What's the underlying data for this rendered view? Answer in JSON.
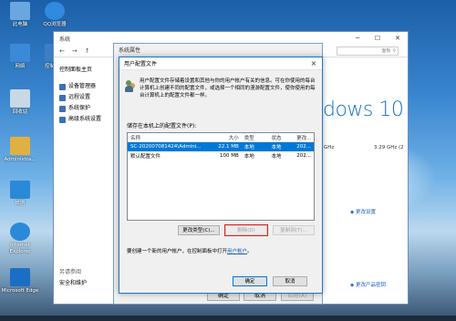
{
  "desktop": {
    "icons": [
      {
        "label": "此电脑",
        "icon": "computer-icon",
        "color": "#6aa7e0"
      },
      {
        "label": "QQ浏览器",
        "icon": "qq-browser-icon",
        "color": "#2f8ae0"
      },
      {
        "label": "网络",
        "icon": "network-icon",
        "color": "#3a8ad8"
      },
      {
        "label": "控制面板",
        "icon": "control-panel-icon",
        "color": "#3b7fc4"
      },
      {
        "label": "回收站",
        "icon": "recycle-bin-icon",
        "color": "#c9d8e6"
      },
      {
        "label": "Administra...",
        "icon": "user-folder-icon",
        "color": "#e0b040"
      },
      {
        "label": "IE浏",
        "icon": "ie-icon",
        "color": "#2a8ad8"
      },
      {
        "label": "Internet Explorer",
        "icon": "internet-explorer-icon",
        "color": "#2a8ad8"
      },
      {
        "label": "Microsoft Edge",
        "icon": "edge-icon",
        "color": "#1a6fc4"
      }
    ]
  },
  "system_window": {
    "title": "系统",
    "nav_arrows": [
      "←",
      "→",
      "↑"
    ],
    "search_placeholder": "面板",
    "sidebar_heading": "控制面板主页",
    "sidebar_items": [
      "设备管理器",
      "远程设置",
      "系统保护",
      "高级系统设置"
    ],
    "see_also_heading": "另请参阅",
    "see_also_items": [
      "安全和维护"
    ],
    "windows_logo_text": "dows 10",
    "spec_left": "GHz",
    "spec_right": "3.29 GHz (2",
    "change_settings": "更改设置",
    "change_key": "更改产品密钥"
  },
  "properties_dialog": {
    "title": "系统属性",
    "ok": "确定",
    "cancel": "取消",
    "apply": "应用(A)"
  },
  "profiles_dialog": {
    "title": "用户配置文件",
    "close": "×",
    "description": "用户配置文件存储着设置和其他与你的用户帐户有关的信息。可在你使用的每台计算机上创建不同的配置文件，或选择一个相同的漫游配置文件，使你使用的每台计算机上的配置文件都一样。",
    "list_label": "储存在本机上的配置文件(P):",
    "columns": [
      "名称",
      "大小",
      "类型",
      "状态",
      "更改..."
    ],
    "rows": [
      {
        "name": "SC-202007081424\\Admini...",
        "size": "22.1 MB",
        "type": "本地",
        "status": "本地",
        "changed": "202...",
        "selected": true
      },
      {
        "name": "默认配置文件",
        "size": "100 MB",
        "type": "本地",
        "status": "本地",
        "changed": "202...",
        "selected": false
      }
    ],
    "change_type_button": "更改类型(C)...",
    "delete_button": "删除(D)",
    "copy_to_button": "复制到(T)...",
    "hint_prefix": "要创建一个新的用户帐户，在控制面板中打开",
    "hint_link": "用户帐户",
    "hint_suffix": "。",
    "ok": "确定",
    "cancel": "取消"
  },
  "colors": {
    "accent": "#0078d7",
    "link": "#1a5fb4",
    "highlight_box": "#e02020"
  }
}
